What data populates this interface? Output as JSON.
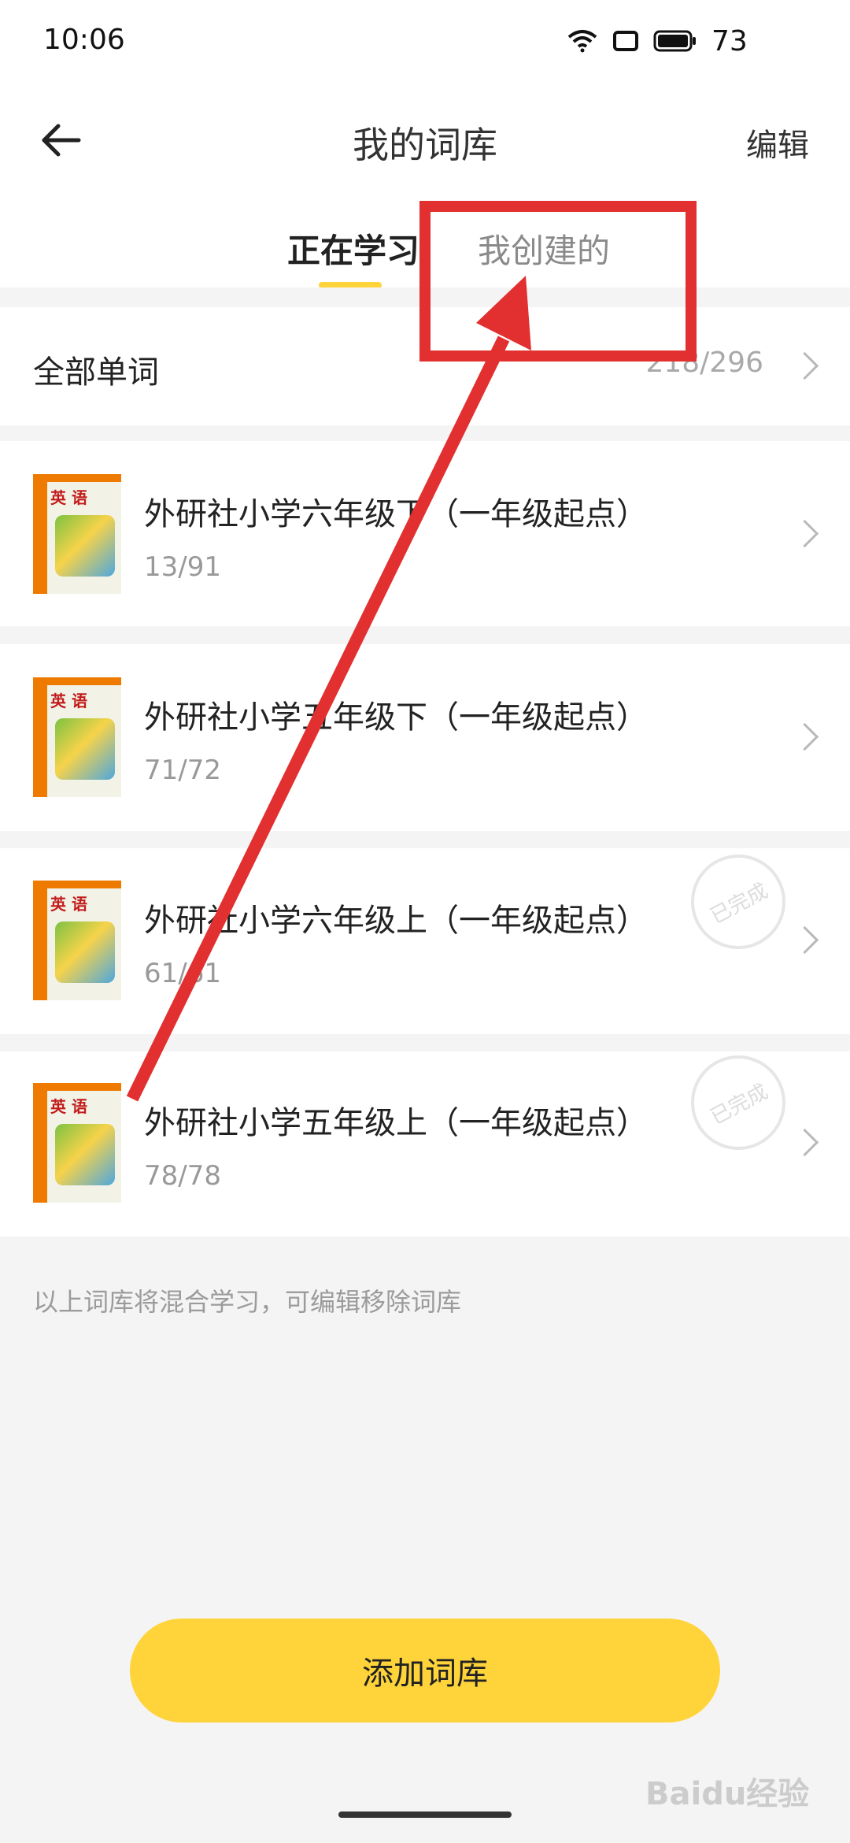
{
  "status_bar": {
    "time": "10:06",
    "battery": "73"
  },
  "header": {
    "title": "我的词库",
    "edit": "编辑"
  },
  "tabs": [
    {
      "label": "正在学习",
      "active": true
    },
    {
      "label": "我创建的",
      "active": false
    }
  ],
  "all_words": {
    "label": "全部单词",
    "count": "218/296"
  },
  "books": [
    {
      "title": "外研社小学六年级下（一年级起点）",
      "count": "13/91",
      "completed": false,
      "cover_word": "英 语"
    },
    {
      "title": "外研社小学五年级下（一年级起点）",
      "count": "71/72",
      "completed": false,
      "cover_word": "英 语"
    },
    {
      "title": "外研社小学六年级上（一年级起点）",
      "count": "61/61",
      "completed": true,
      "cover_word": "英 语"
    },
    {
      "title": "外研社小学五年级上（一年级起点）",
      "count": "78/78",
      "completed": true,
      "cover_word": "英 语"
    }
  ],
  "completed_stamp": "已完成",
  "footnote": "以上词库将混合学习，可编辑移除词库",
  "add_button": "添加词库",
  "watermark": "Baidu经验",
  "colors": {
    "accent": "#ffd43a",
    "annotation": "#e23030"
  }
}
